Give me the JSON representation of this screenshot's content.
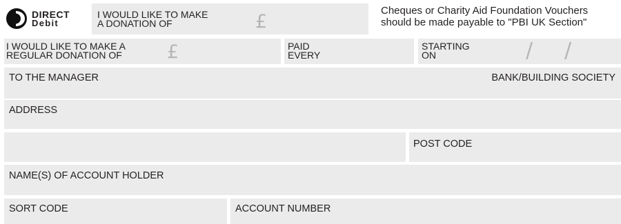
{
  "logo": {
    "word1": "DIRECT",
    "word2": "Debit"
  },
  "donation": {
    "line1": "I WOULD LIKE TO MAKE",
    "line2": "A DONATION OF",
    "currency": "£"
  },
  "cheques": {
    "line1": "Cheques or Charity Aid Foundation Vouchers",
    "line2": "should be made payable to \"PBI UK Section\""
  },
  "regular": {
    "line1": "I WOULD LIKE TO MAKE A",
    "line2": "REGULAR DONATION OF",
    "currency": "£"
  },
  "paid": {
    "line1": "PAID",
    "line2": "EVERY"
  },
  "starting": {
    "line1": "STARTING",
    "line2": "ON",
    "sep": "/"
  },
  "fields": {
    "manager": "TO THE MANAGER",
    "bank": "BANK/BUILDING SOCIETY",
    "address": "ADDRESS",
    "postcode": "POST CODE",
    "account_holder": "NAME(S) OF ACCOUNT HOLDER",
    "sort_code": "SORT CODE",
    "account_number": "ACCOUNT NUMBER"
  }
}
